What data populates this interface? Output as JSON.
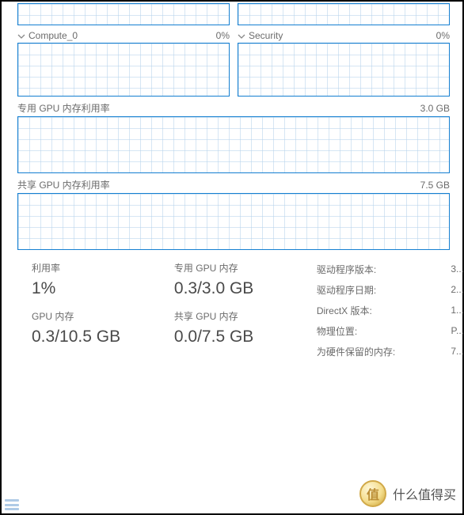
{
  "sections": {
    "compute0": {
      "label": "Compute_0",
      "pct": "0%"
    },
    "security": {
      "label": "Security",
      "pct": "0%"
    },
    "dedicated_mem": {
      "label": "专用 GPU 内存利用率",
      "max": "3.0 GB"
    },
    "shared_mem": {
      "label": "共享 GPU 内存利用率",
      "max": "7.5 GB"
    }
  },
  "stats": {
    "util_label": "利用率",
    "util_value": "1%",
    "gpu_mem_label": "GPU 内存",
    "gpu_mem_value": "0.3/10.5 GB",
    "dedicated_label": "专用 GPU 内存",
    "dedicated_value": "0.3/3.0 GB",
    "shared_label": "共享 GPU 内存",
    "shared_value": "0.0/7.5 GB"
  },
  "details": {
    "driver_version_label": "驱动程序版本:",
    "driver_version_value": "3...",
    "driver_date_label": "驱动程序日期:",
    "driver_date_value": "2...",
    "directx_label": "DirectX 版本:",
    "directx_value": "1...",
    "location_label": "物理位置:",
    "location_value": "P...",
    "reserved_label": "为硬件保留的内存:",
    "reserved_value": "7..."
  },
  "watermark": {
    "coin": "值",
    "text": "什么值得买"
  },
  "chart_data": [
    {
      "type": "line",
      "title": "Compute_0",
      "ylim": [
        0,
        100
      ],
      "x": "time",
      "values": [
        0,
        0,
        0,
        0,
        0,
        0,
        0,
        0,
        0,
        0,
        0,
        0,
        0,
        0,
        0,
        0,
        0,
        0,
        0,
        0
      ]
    },
    {
      "type": "line",
      "title": "Security",
      "ylim": [
        0,
        100
      ],
      "x": "time",
      "values": [
        0,
        0,
        0,
        0,
        0,
        0,
        0,
        0,
        0,
        0,
        0,
        0,
        0,
        0,
        0,
        0,
        0,
        0,
        0,
        0
      ]
    },
    {
      "type": "area",
      "title": "专用 GPU 内存利用率",
      "ylabel": "GB",
      "ylim": [
        0,
        3.0
      ],
      "x": "time",
      "values": [
        0.15,
        0.15,
        0.15,
        0.15,
        0.15,
        0.15,
        0.15,
        0.15,
        0.15,
        0.15,
        0.15,
        0.15,
        0.18,
        0.22,
        0.3,
        0.3,
        0.3,
        0.3,
        0.3,
        0.3
      ]
    },
    {
      "type": "area",
      "title": "共享 GPU 内存利用率",
      "ylabel": "GB",
      "ylim": [
        0,
        7.5
      ],
      "x": "time",
      "values": [
        0,
        0,
        0,
        0,
        0,
        0,
        0,
        0,
        0,
        0,
        0,
        0,
        0,
        0,
        0,
        0,
        0,
        0,
        0,
        0
      ]
    }
  ]
}
